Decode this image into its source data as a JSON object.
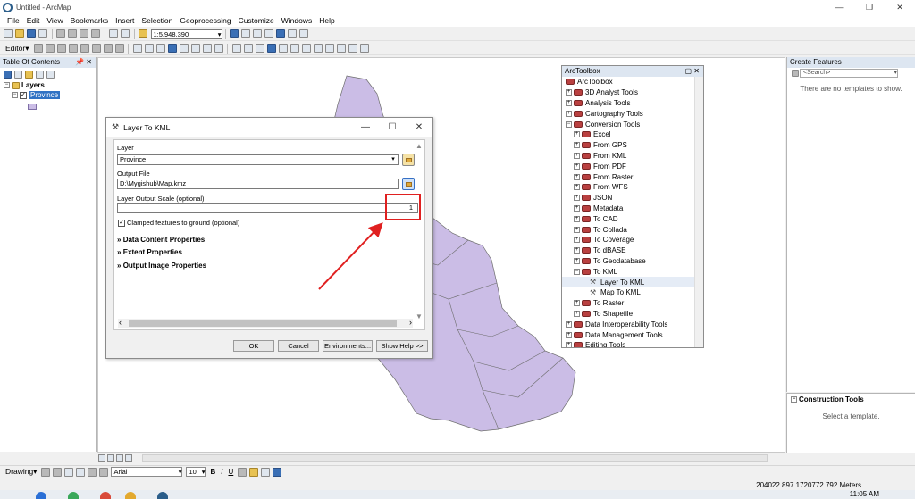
{
  "window": {
    "title": "Untitled - ArcMap",
    "min_icon": "—",
    "max_icon": "❐",
    "close_icon": "✕"
  },
  "menu": [
    "File",
    "Edit",
    "View",
    "Bookmarks",
    "Insert",
    "Selection",
    "Geoprocessing",
    "Customize",
    "Windows",
    "Help"
  ],
  "toolbar": {
    "scale": "1:5,948,390",
    "editor_label": "Editor▾"
  },
  "toc": {
    "title": "Table Of Contents",
    "pin": "📌 ✕",
    "layers_label": "Layers",
    "layer_name": "Province",
    "check_mark": "✓",
    "collapse_glyph": "−"
  },
  "create_features": {
    "title": "Create Features",
    "search_placeholder": "<Search>",
    "empty_text": "There are no templates to show."
  },
  "construction": {
    "title": "Construction Tools",
    "message": "Select a template."
  },
  "arctoolbox": {
    "title": "ArcToolbox",
    "root": "ArcToolbox",
    "items": [
      {
        "label": "3D Analyst Tools",
        "indent": 0,
        "icon": "toolbox-icon",
        "exp": "+"
      },
      {
        "label": "Analysis Tools",
        "indent": 0,
        "icon": "toolbox-icon",
        "exp": "+"
      },
      {
        "label": "Cartography Tools",
        "indent": 0,
        "icon": "toolbox-icon",
        "exp": "+"
      },
      {
        "label": "Conversion Tools",
        "indent": 0,
        "icon": "toolbox-icon",
        "exp": "−"
      },
      {
        "label": "Excel",
        "indent": 1,
        "icon": "toolset-icon",
        "exp": "+"
      },
      {
        "label": "From GPS",
        "indent": 1,
        "icon": "toolset-icon",
        "exp": "+"
      },
      {
        "label": "From KML",
        "indent": 1,
        "icon": "toolset-icon",
        "exp": "+"
      },
      {
        "label": "From PDF",
        "indent": 1,
        "icon": "toolset-icon",
        "exp": "+"
      },
      {
        "label": "From Raster",
        "indent": 1,
        "icon": "toolset-icon",
        "exp": "+"
      },
      {
        "label": "From WFS",
        "indent": 1,
        "icon": "toolset-icon",
        "exp": "+"
      },
      {
        "label": "JSON",
        "indent": 1,
        "icon": "toolset-icon",
        "exp": "+"
      },
      {
        "label": "Metadata",
        "indent": 1,
        "icon": "toolset-icon",
        "exp": "+"
      },
      {
        "label": "To CAD",
        "indent": 1,
        "icon": "toolset-icon",
        "exp": "+"
      },
      {
        "label": "To Collada",
        "indent": 1,
        "icon": "toolset-icon",
        "exp": "+"
      },
      {
        "label": "To Coverage",
        "indent": 1,
        "icon": "toolset-icon",
        "exp": "+"
      },
      {
        "label": "To dBASE",
        "indent": 1,
        "icon": "toolset-icon",
        "exp": "+"
      },
      {
        "label": "To Geodatabase",
        "indent": 1,
        "icon": "toolset-icon",
        "exp": "+"
      },
      {
        "label": "To KML",
        "indent": 1,
        "icon": "toolset-icon",
        "exp": "−"
      },
      {
        "label": "Layer To KML",
        "indent": 2,
        "icon": "hammer-icon",
        "exp": ""
      },
      {
        "label": "Map To KML",
        "indent": 2,
        "icon": "hammer-icon",
        "exp": ""
      },
      {
        "label": "To Raster",
        "indent": 1,
        "icon": "toolset-icon",
        "exp": "+"
      },
      {
        "label": "To Shapefile",
        "indent": 1,
        "icon": "toolset-icon",
        "exp": "+"
      },
      {
        "label": "Data Interoperability Tools",
        "indent": 0,
        "icon": "toolbox-icon",
        "exp": "+"
      },
      {
        "label": "Data Management Tools",
        "indent": 0,
        "icon": "toolbox-icon",
        "exp": "+"
      },
      {
        "label": "Editing Tools",
        "indent": 0,
        "icon": "toolbox-icon",
        "exp": "+"
      }
    ]
  },
  "dialog": {
    "title": "Layer To KML",
    "layer_label": "Layer",
    "layer_value": "Province",
    "output_label": "Output File",
    "output_value": "D:\\Mygishub\\Map.kmz",
    "scale_label": "Layer Output Scale (optional)",
    "scale_value": "1",
    "clamp_label": "Clamped features to ground (optional)",
    "sections": [
      "Data Content Properties",
      "Extent Properties",
      "Output Image Properties"
    ],
    "ok": "OK",
    "cancel": "Cancel",
    "environments": "Environments...",
    "show_help": "Show Help >>"
  },
  "drawing": {
    "label": "Drawing▾",
    "font": "Arial",
    "size": "10",
    "bold": "B",
    "italic": "I",
    "underline": "U"
  },
  "status": {
    "coords": "204022.897  1720772.792 Meters"
  },
  "taskbar": {
    "clock": "11:05 AM"
  },
  "colors": {
    "accent": "#3072c4",
    "polygon_fill": "#cbbde6",
    "arrow": "#e02020"
  }
}
